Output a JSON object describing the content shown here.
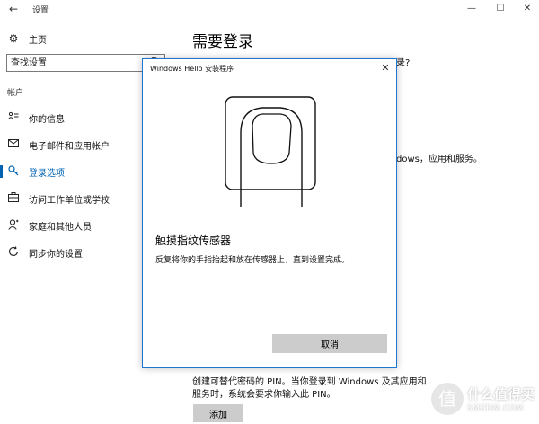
{
  "window": {
    "title": "设置",
    "back_glyph": "←",
    "min_glyph": "—",
    "max_glyph": "☐",
    "close_glyph": "✕"
  },
  "sidebar": {
    "home_label": "主页",
    "home_icon": "gear-icon",
    "search_placeholder": "查找设置",
    "section_label": "帐户",
    "items": [
      {
        "label": "你的信息",
        "icon": "contact-card-icon",
        "active": false
      },
      {
        "label": "电子邮件和应用帐户",
        "icon": "mail-icon",
        "active": false
      },
      {
        "label": "登录选项",
        "icon": "key-icon",
        "active": true
      },
      {
        "label": "访问工作单位或学校",
        "icon": "briefcase-icon",
        "active": false
      },
      {
        "label": "家庭和其他人员",
        "icon": "person-icon",
        "active": false
      },
      {
        "label": "同步你的设置",
        "icon": "sync-icon",
        "active": false
      }
    ]
  },
  "main": {
    "title": "需要登录",
    "peek_top": "录?",
    "peek_mid": "dows，应用和服务。",
    "pin_description": "创建可替代密码的 PIN。当你登录到 Windows 及其应用和服务时，系统会要求你输入此 PIN。",
    "add_label": "添加"
  },
  "dialog": {
    "title": "Windows Hello 安装程序",
    "close_glyph": "✕",
    "heading": "触摸指纹传感器",
    "instruction": "反复将你的手指抬起和放在传感器上，直到设置完成。",
    "cancel_label": "取消"
  },
  "watermark": {
    "main": "什么值得买",
    "sub": "SMZDM.COM",
    "glyph": "值"
  },
  "colors": {
    "accent": "#0063b1",
    "dialog_border": "#1e78d2",
    "button_bg": "#cccccc"
  }
}
